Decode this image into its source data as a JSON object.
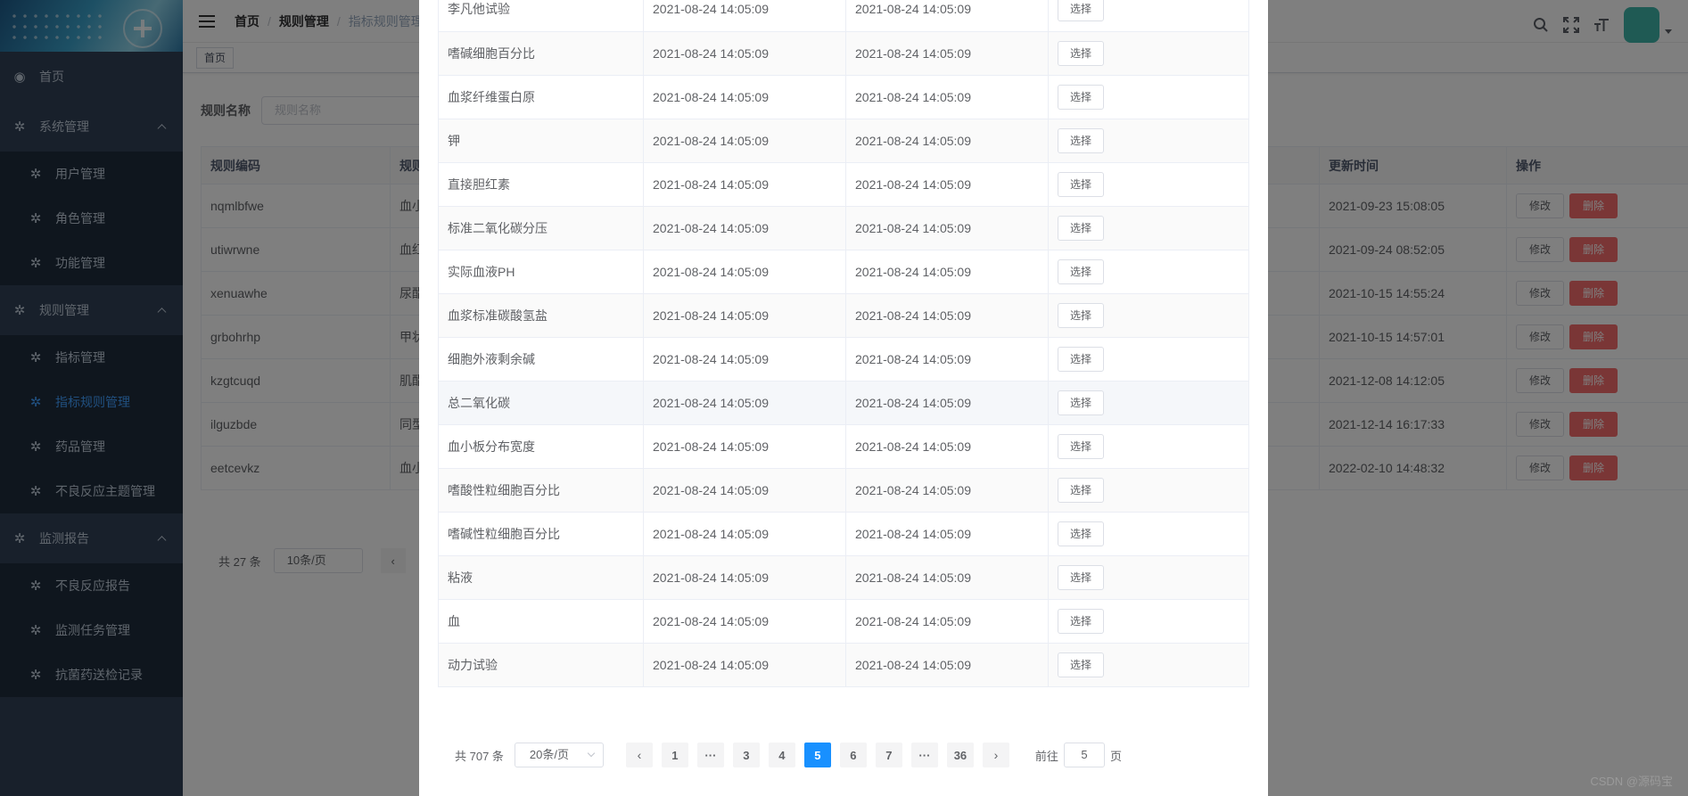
{
  "sidebar": {
    "items": [
      {
        "label": "首页",
        "icon": "dashboard-icon",
        "type": "top"
      },
      {
        "label": "系统管理",
        "icon": "gear-icon",
        "type": "group"
      },
      {
        "label": "用户管理",
        "icon": "gear-icon",
        "type": "sub"
      },
      {
        "label": "角色管理",
        "icon": "gear-icon",
        "type": "sub"
      },
      {
        "label": "功能管理",
        "icon": "gear-icon",
        "type": "sub"
      },
      {
        "label": "规则管理",
        "icon": "gear-icon",
        "type": "group"
      },
      {
        "label": "指标管理",
        "icon": "gear-icon",
        "type": "sub"
      },
      {
        "label": "指标规则管理",
        "icon": "gear-icon",
        "type": "sub",
        "active": true
      },
      {
        "label": "药品管理",
        "icon": "gear-icon",
        "type": "sub"
      },
      {
        "label": "不良反应主题管理",
        "icon": "gear-icon",
        "type": "sub"
      },
      {
        "label": "监测报告",
        "icon": "gear-icon",
        "type": "group"
      },
      {
        "label": "不良反应报告",
        "icon": "gear-icon",
        "type": "sub"
      },
      {
        "label": "监测任务管理",
        "icon": "gear-icon",
        "type": "sub"
      },
      {
        "label": "抗菌药送检记录",
        "icon": "gear-icon",
        "type": "sub"
      }
    ]
  },
  "navbar": {
    "breadcrumb": [
      "首页",
      "规则管理",
      "指标规则管理"
    ]
  },
  "tags": {
    "home": "首页"
  },
  "search": {
    "label": "规则名称",
    "placeholder": "规则名称"
  },
  "bg_table": {
    "headers": [
      "规则编码",
      "规则",
      "更新时间",
      "操作"
    ],
    "edit_label": "修改",
    "delete_label": "删除",
    "rows": [
      {
        "code": "nqmlbfwe",
        "name": "血小",
        "updated": "2021-09-23 15:08:05"
      },
      {
        "code": "utiwrwne",
        "name": "血红",
        "updated": "2021-09-24 08:52:05"
      },
      {
        "code": "xenuawhe",
        "name": "尿酯",
        "updated": "2021-10-15 14:55:24"
      },
      {
        "code": "grbohrhp",
        "name": "甲状",
        "updated": "2021-10-15 14:57:01"
      },
      {
        "code": "kzgtcuqd",
        "name": "肌酯",
        "updated": "2021-12-08 14:12:05"
      },
      {
        "code": "ilguzbde",
        "name": "同型",
        "updated": "2021-12-14 16:17:33"
      },
      {
        "code": "eetcevkz",
        "name": "血小",
        "updated": "2022-02-10 14:48:32"
      }
    ]
  },
  "bg_pager": {
    "total": "共 27 条",
    "size": "10条/页"
  },
  "dialog": {
    "select_label": "选择",
    "rows": [
      {
        "name": "李凡他试验",
        "t1": "2021-08-24 14:05:09",
        "t2": "2021-08-24 14:05:09"
      },
      {
        "name": "嗜碱细胞百分比",
        "t1": "2021-08-24 14:05:09",
        "t2": "2021-08-24 14:05:09"
      },
      {
        "name": "血浆纤维蛋白原",
        "t1": "2021-08-24 14:05:09",
        "t2": "2021-08-24 14:05:09"
      },
      {
        "name": "钾",
        "t1": "2021-08-24 14:05:09",
        "t2": "2021-08-24 14:05:09"
      },
      {
        "name": "直接胆红素",
        "t1": "2021-08-24 14:05:09",
        "t2": "2021-08-24 14:05:09"
      },
      {
        "name": "标准二氧化碳分压",
        "t1": "2021-08-24 14:05:09",
        "t2": "2021-08-24 14:05:09"
      },
      {
        "name": "实际血液PH",
        "t1": "2021-08-24 14:05:09",
        "t2": "2021-08-24 14:05:09"
      },
      {
        "name": "血浆标准碳酸氢盐",
        "t1": "2021-08-24 14:05:09",
        "t2": "2021-08-24 14:05:09"
      },
      {
        "name": "细胞外液剩余碱",
        "t1": "2021-08-24 14:05:09",
        "t2": "2021-08-24 14:05:09"
      },
      {
        "name": "总二氧化碳",
        "t1": "2021-08-24 14:05:09",
        "t2": "2021-08-24 14:05:09",
        "hover": true
      },
      {
        "name": "血小板分布宽度",
        "t1": "2021-08-24 14:05:09",
        "t2": "2021-08-24 14:05:09"
      },
      {
        "name": "嗜酸性粒细胞百分比",
        "t1": "2021-08-24 14:05:09",
        "t2": "2021-08-24 14:05:09"
      },
      {
        "name": "嗜碱性粒细胞百分比",
        "t1": "2021-08-24 14:05:09",
        "t2": "2021-08-24 14:05:09"
      },
      {
        "name": "粘液",
        "t1": "2021-08-24 14:05:09",
        "t2": "2021-08-24 14:05:09"
      },
      {
        "name": "血",
        "t1": "2021-08-24 14:05:09",
        "t2": "2021-08-24 14:05:09"
      },
      {
        "name": "动力试验",
        "t1": "2021-08-24 14:05:09",
        "t2": "2021-08-24 14:05:09"
      }
    ],
    "pager": {
      "total": "共 707 条",
      "size": "20条/页",
      "pages": [
        "1",
        "···",
        "3",
        "4",
        "5",
        "6",
        "7",
        "···",
        "36"
      ],
      "current": "5",
      "jump_prefix": "前往",
      "jump_value": "5",
      "jump_suffix": "页"
    }
  },
  "watermark": "CSDN @源码宝",
  "colors": {
    "sidebar_bg": "#304156",
    "active": "#409eff",
    "primary": "#1890ff",
    "danger": "#f56c6c",
    "avatar": "#3fb5a8"
  }
}
